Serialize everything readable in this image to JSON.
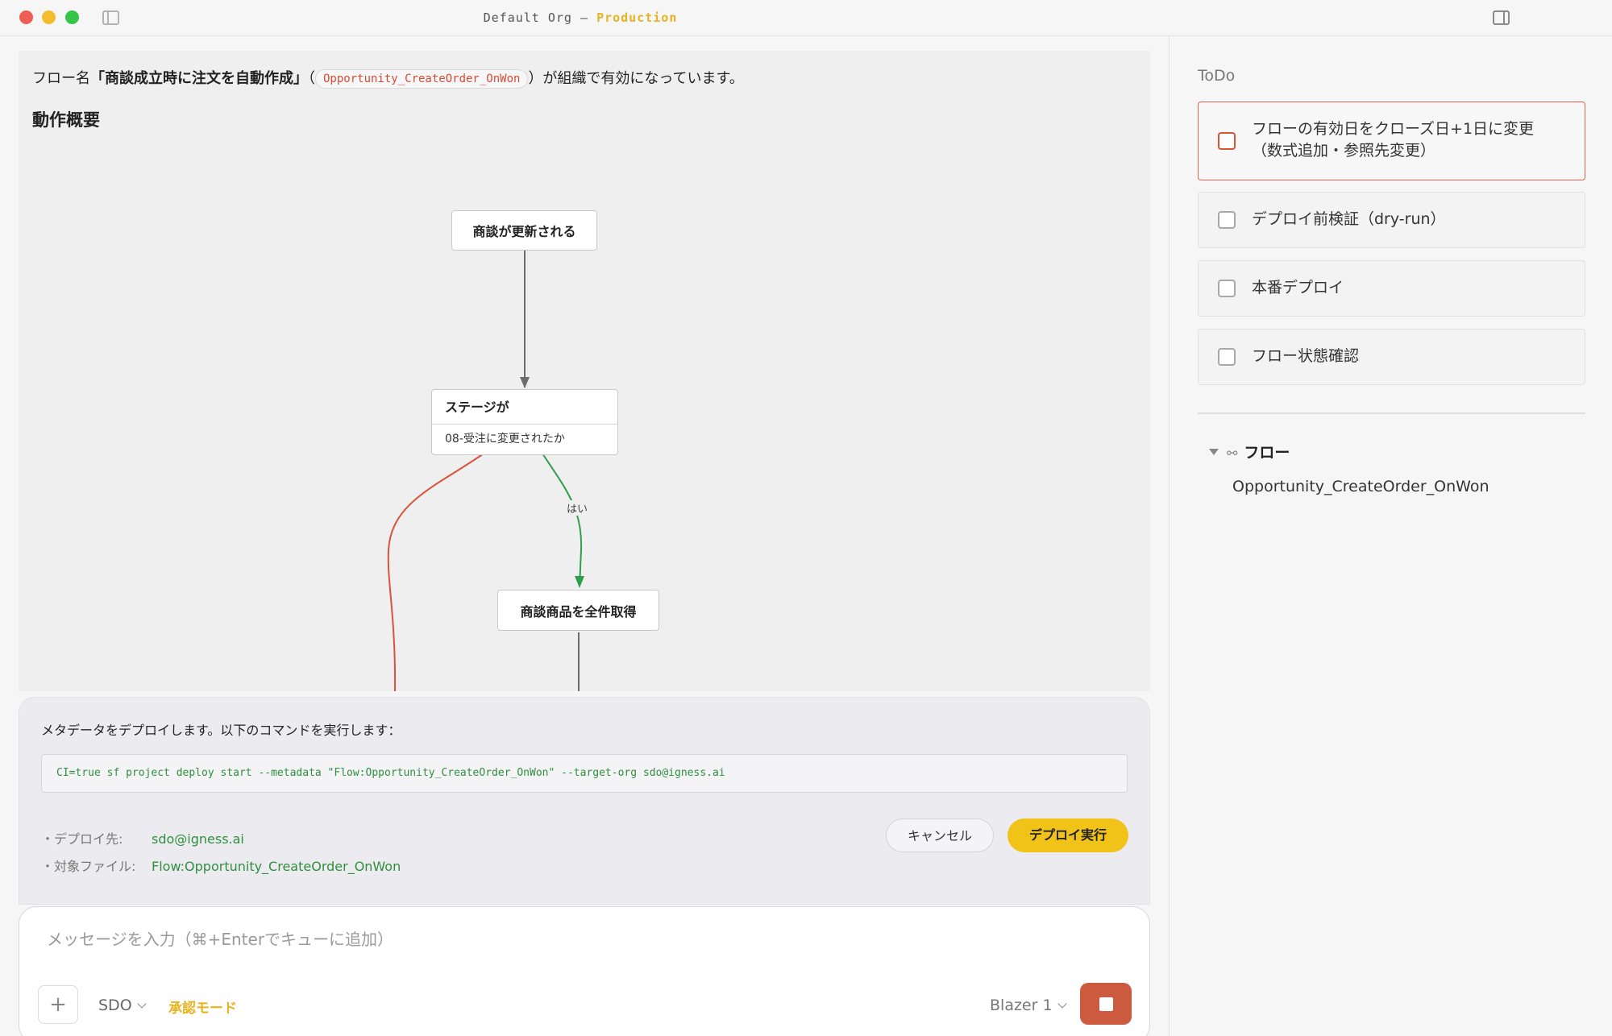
{
  "window": {
    "title_prefix": "Default Org – ",
    "environment": "Production"
  },
  "doc": {
    "intro_before": "フロー名",
    "flow_label": "「商談成立時に注文を自動作成」",
    "paren_open": "（",
    "api_name": "Opportunity_CreateOrder_OnWon",
    "intro_after": "）が組織で有効になっています。",
    "section_heading": "動作概要",
    "diagram": {
      "start_node": "商談が更新される",
      "decision_title": "ステージが",
      "decision_condition": "08-受注に変更されたか",
      "yes_label": "はい",
      "action_node": "商談商品を全件取得"
    }
  },
  "deploy": {
    "description": "メタデータをデプロイします。以下のコマンドを実行します：",
    "command": "CI=true sf project deploy start --metadata \"Flow:Opportunity_CreateOrder_OnWon\" --target-org sdo@igness.ai",
    "target_key": "・デプロイ先:",
    "target_value": "sdo@igness.ai",
    "file_key": "・対象ファイル:",
    "file_value": "Flow:Opportunity_CreateOrder_OnWon",
    "cancel_label": "キャンセル",
    "deploy_label": "デプロイ実行"
  },
  "composer": {
    "placeholder": "メッセージを入力（⌘+Enterでキューに追加）",
    "plus_label": "+",
    "org": "SDO",
    "mode": "承認モード",
    "model": "Blazer 1"
  },
  "sidebar": {
    "todo_heading": "ToDo",
    "todos": [
      {
        "label": "フローの有効日をクローズ日+1日に変更\n（数式追加・参照先変更）",
        "checked": false,
        "active": true
      },
      {
        "label": "デプロイ前検証（dry-run）",
        "checked": false,
        "active": false
      },
      {
        "label": "本番デプロイ",
        "checked": false,
        "active": false
      },
      {
        "label": "フロー状態確認",
        "checked": false,
        "active": false
      }
    ],
    "flow_section": {
      "heading": "フロー",
      "icon": "link-icon",
      "item": "Opportunity_CreateOrder_OnWon"
    }
  },
  "colors": {
    "accent_yellow": "#f1c217",
    "env_yellow": "#e8b320",
    "code_red": "#d94a35",
    "code_green": "#2f8f3e",
    "stop_red": "#cc5a3f",
    "edge_yes": "#2e9e4b",
    "edge_no": "#d9533b"
  }
}
